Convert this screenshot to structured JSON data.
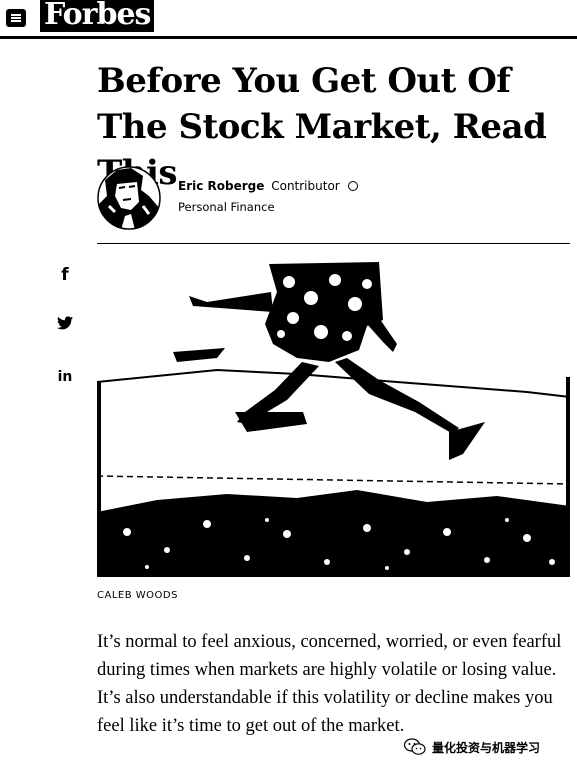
{
  "header": {
    "logo": "Forbes",
    "menu_icon": "hamburger-menu-icon"
  },
  "article": {
    "title": "Before You Get Out Of The Stock Market, Read This",
    "author": {
      "name": "Eric Roberge",
      "role": "Contributor",
      "channel": "Personal Finance"
    },
    "image_credit": "CALEB WOODS",
    "body": "It’s normal to feel anxious, concerned, worried, or even fearful during times when markets are highly volatile or losing value. It’s also understandable if this volatility or decline makes you feel like it’s time to get out of the market."
  },
  "share": {
    "facebook": "f",
    "linkedin": "in"
  },
  "watermark": {
    "text": "量化投资与机器学习"
  }
}
